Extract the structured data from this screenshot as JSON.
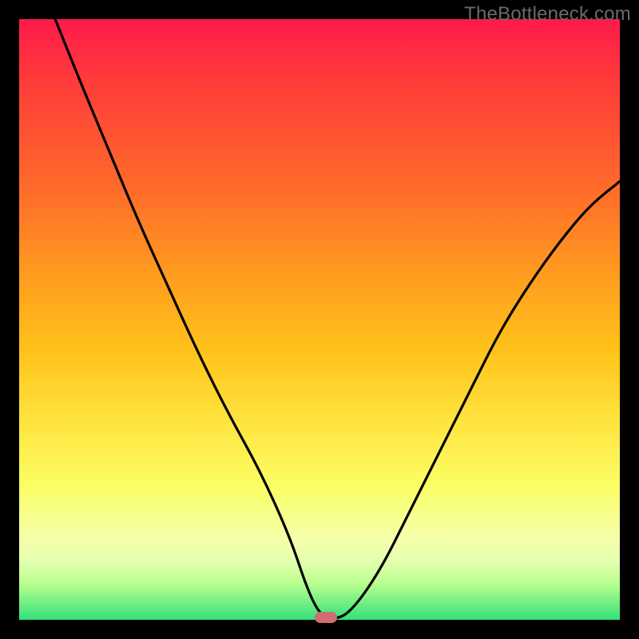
{
  "watermark": "TheBottleneck.com",
  "chart_data": {
    "type": "line",
    "title": "",
    "xlabel": "",
    "ylabel": "",
    "xlim": [
      0,
      100
    ],
    "ylim": [
      0,
      100
    ],
    "grid": false,
    "legend": false,
    "annotations": [],
    "series": [
      {
        "name": "bottleneck-curve",
        "color": "#000000",
        "x": [
          6,
          10,
          15,
          20,
          25,
          30,
          35,
          40,
          45,
          48,
          50,
          52,
          55,
          60,
          65,
          70,
          75,
          80,
          85,
          90,
          95,
          100
        ],
        "values": [
          100,
          90,
          78,
          66,
          55,
          44,
          34,
          25,
          14,
          5,
          1,
          0,
          1,
          8,
          18,
          28,
          38,
          48,
          56,
          63,
          69,
          73
        ]
      }
    ],
    "marker": {
      "x": 51,
      "y": 0,
      "color": "#cf6e70"
    }
  },
  "colors": {
    "frame": "#000000",
    "gradient_top": "#ff1a4b",
    "gradient_bottom": "#33e07a",
    "curve": "#000000",
    "marker": "#cf6e70",
    "watermark": "#6a6a6a"
  }
}
